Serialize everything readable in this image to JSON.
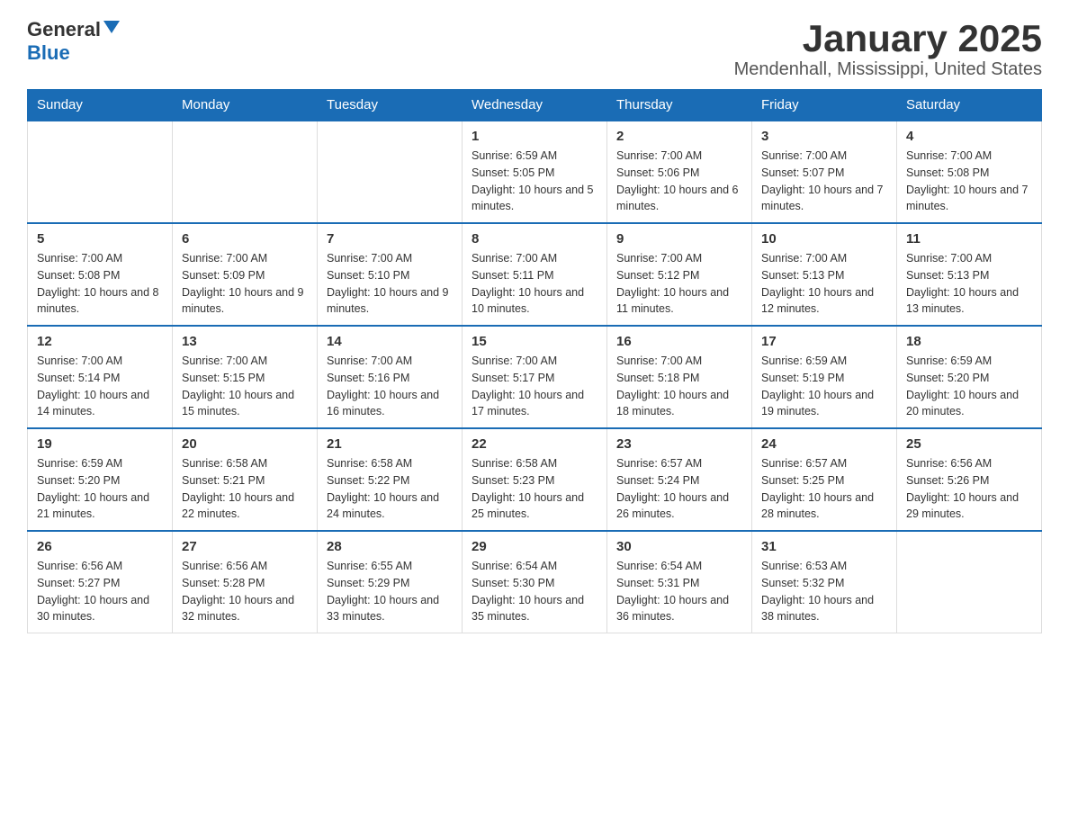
{
  "header": {
    "logo_general": "General",
    "logo_blue": "Blue",
    "title": "January 2025",
    "subtitle": "Mendenhall, Mississippi, United States"
  },
  "weekdays": [
    "Sunday",
    "Monday",
    "Tuesday",
    "Wednesday",
    "Thursday",
    "Friday",
    "Saturday"
  ],
  "weeks": [
    [
      {
        "day": "",
        "sunrise": "",
        "sunset": "",
        "daylight": ""
      },
      {
        "day": "",
        "sunrise": "",
        "sunset": "",
        "daylight": ""
      },
      {
        "day": "",
        "sunrise": "",
        "sunset": "",
        "daylight": ""
      },
      {
        "day": "1",
        "sunrise": "Sunrise: 6:59 AM",
        "sunset": "Sunset: 5:05 PM",
        "daylight": "Daylight: 10 hours and 5 minutes."
      },
      {
        "day": "2",
        "sunrise": "Sunrise: 7:00 AM",
        "sunset": "Sunset: 5:06 PM",
        "daylight": "Daylight: 10 hours and 6 minutes."
      },
      {
        "day": "3",
        "sunrise": "Sunrise: 7:00 AM",
        "sunset": "Sunset: 5:07 PM",
        "daylight": "Daylight: 10 hours and 7 minutes."
      },
      {
        "day": "4",
        "sunrise": "Sunrise: 7:00 AM",
        "sunset": "Sunset: 5:08 PM",
        "daylight": "Daylight: 10 hours and 7 minutes."
      }
    ],
    [
      {
        "day": "5",
        "sunrise": "Sunrise: 7:00 AM",
        "sunset": "Sunset: 5:08 PM",
        "daylight": "Daylight: 10 hours and 8 minutes."
      },
      {
        "day": "6",
        "sunrise": "Sunrise: 7:00 AM",
        "sunset": "Sunset: 5:09 PM",
        "daylight": "Daylight: 10 hours and 9 minutes."
      },
      {
        "day": "7",
        "sunrise": "Sunrise: 7:00 AM",
        "sunset": "Sunset: 5:10 PM",
        "daylight": "Daylight: 10 hours and 9 minutes."
      },
      {
        "day": "8",
        "sunrise": "Sunrise: 7:00 AM",
        "sunset": "Sunset: 5:11 PM",
        "daylight": "Daylight: 10 hours and 10 minutes."
      },
      {
        "day": "9",
        "sunrise": "Sunrise: 7:00 AM",
        "sunset": "Sunset: 5:12 PM",
        "daylight": "Daylight: 10 hours and 11 minutes."
      },
      {
        "day": "10",
        "sunrise": "Sunrise: 7:00 AM",
        "sunset": "Sunset: 5:13 PM",
        "daylight": "Daylight: 10 hours and 12 minutes."
      },
      {
        "day": "11",
        "sunrise": "Sunrise: 7:00 AM",
        "sunset": "Sunset: 5:13 PM",
        "daylight": "Daylight: 10 hours and 13 minutes."
      }
    ],
    [
      {
        "day": "12",
        "sunrise": "Sunrise: 7:00 AM",
        "sunset": "Sunset: 5:14 PM",
        "daylight": "Daylight: 10 hours and 14 minutes."
      },
      {
        "day": "13",
        "sunrise": "Sunrise: 7:00 AM",
        "sunset": "Sunset: 5:15 PM",
        "daylight": "Daylight: 10 hours and 15 minutes."
      },
      {
        "day": "14",
        "sunrise": "Sunrise: 7:00 AM",
        "sunset": "Sunset: 5:16 PM",
        "daylight": "Daylight: 10 hours and 16 minutes."
      },
      {
        "day": "15",
        "sunrise": "Sunrise: 7:00 AM",
        "sunset": "Sunset: 5:17 PM",
        "daylight": "Daylight: 10 hours and 17 minutes."
      },
      {
        "day": "16",
        "sunrise": "Sunrise: 7:00 AM",
        "sunset": "Sunset: 5:18 PM",
        "daylight": "Daylight: 10 hours and 18 minutes."
      },
      {
        "day": "17",
        "sunrise": "Sunrise: 6:59 AM",
        "sunset": "Sunset: 5:19 PM",
        "daylight": "Daylight: 10 hours and 19 minutes."
      },
      {
        "day": "18",
        "sunrise": "Sunrise: 6:59 AM",
        "sunset": "Sunset: 5:20 PM",
        "daylight": "Daylight: 10 hours and 20 minutes."
      }
    ],
    [
      {
        "day": "19",
        "sunrise": "Sunrise: 6:59 AM",
        "sunset": "Sunset: 5:20 PM",
        "daylight": "Daylight: 10 hours and 21 minutes."
      },
      {
        "day": "20",
        "sunrise": "Sunrise: 6:58 AM",
        "sunset": "Sunset: 5:21 PM",
        "daylight": "Daylight: 10 hours and 22 minutes."
      },
      {
        "day": "21",
        "sunrise": "Sunrise: 6:58 AM",
        "sunset": "Sunset: 5:22 PM",
        "daylight": "Daylight: 10 hours and 24 minutes."
      },
      {
        "day": "22",
        "sunrise": "Sunrise: 6:58 AM",
        "sunset": "Sunset: 5:23 PM",
        "daylight": "Daylight: 10 hours and 25 minutes."
      },
      {
        "day": "23",
        "sunrise": "Sunrise: 6:57 AM",
        "sunset": "Sunset: 5:24 PM",
        "daylight": "Daylight: 10 hours and 26 minutes."
      },
      {
        "day": "24",
        "sunrise": "Sunrise: 6:57 AM",
        "sunset": "Sunset: 5:25 PM",
        "daylight": "Daylight: 10 hours and 28 minutes."
      },
      {
        "day": "25",
        "sunrise": "Sunrise: 6:56 AM",
        "sunset": "Sunset: 5:26 PM",
        "daylight": "Daylight: 10 hours and 29 minutes."
      }
    ],
    [
      {
        "day": "26",
        "sunrise": "Sunrise: 6:56 AM",
        "sunset": "Sunset: 5:27 PM",
        "daylight": "Daylight: 10 hours and 30 minutes."
      },
      {
        "day": "27",
        "sunrise": "Sunrise: 6:56 AM",
        "sunset": "Sunset: 5:28 PM",
        "daylight": "Daylight: 10 hours and 32 minutes."
      },
      {
        "day": "28",
        "sunrise": "Sunrise: 6:55 AM",
        "sunset": "Sunset: 5:29 PM",
        "daylight": "Daylight: 10 hours and 33 minutes."
      },
      {
        "day": "29",
        "sunrise": "Sunrise: 6:54 AM",
        "sunset": "Sunset: 5:30 PM",
        "daylight": "Daylight: 10 hours and 35 minutes."
      },
      {
        "day": "30",
        "sunrise": "Sunrise: 6:54 AM",
        "sunset": "Sunset: 5:31 PM",
        "daylight": "Daylight: 10 hours and 36 minutes."
      },
      {
        "day": "31",
        "sunrise": "Sunrise: 6:53 AM",
        "sunset": "Sunset: 5:32 PM",
        "daylight": "Daylight: 10 hours and 38 minutes."
      },
      {
        "day": "",
        "sunrise": "",
        "sunset": "",
        "daylight": ""
      }
    ]
  ]
}
